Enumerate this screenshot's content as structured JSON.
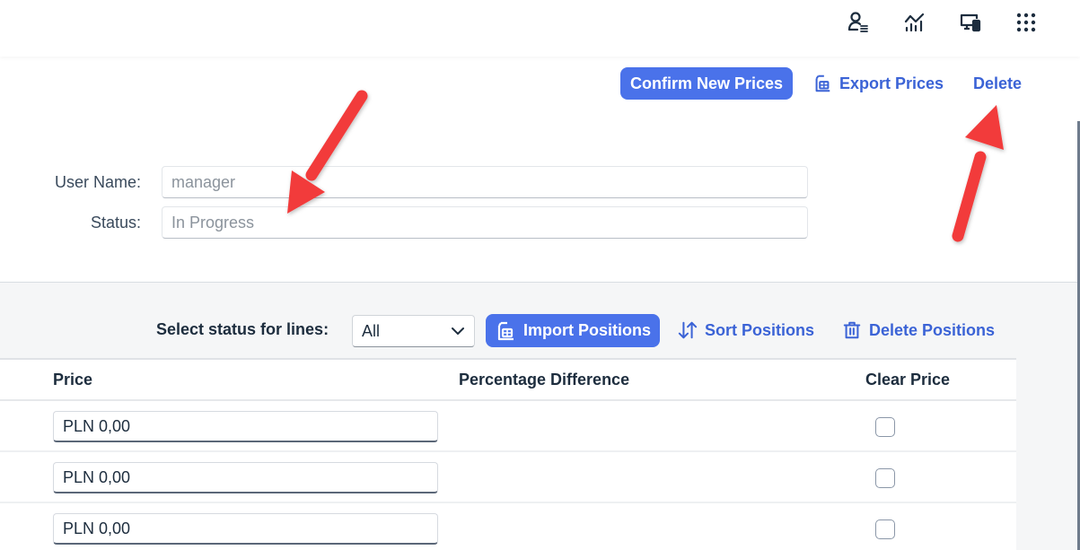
{
  "shellbar": {
    "icons": [
      {
        "name": "user-settings-icon"
      },
      {
        "name": "analytics-icon"
      },
      {
        "name": "device-icon"
      },
      {
        "name": "app-grid-icon"
      }
    ]
  },
  "header": {
    "actions": {
      "confirm_label": "Confirm New Prices",
      "export_label": "Export Prices",
      "delete_label": "Delete"
    },
    "fields": {
      "user_name_label": "User Name:",
      "user_name_value": "manager",
      "status_label": "Status:",
      "status_value": "In Progress"
    }
  },
  "toolbar": {
    "status_filter_label": "Select status for lines:",
    "status_filter_value": "All",
    "import_label": "Import Positions",
    "sort_label": "Sort Positions",
    "delete_label": "Delete Positions"
  },
  "table": {
    "columns": [
      "Price",
      "Percentage Difference",
      "Clear Price"
    ],
    "rows": [
      {
        "price": "PLN 0,00",
        "percentage_difference": "",
        "clear_price": false
      },
      {
        "price": "PLN 0,00",
        "percentage_difference": "",
        "clear_price": false
      },
      {
        "price": "PLN 0,00",
        "percentage_difference": "",
        "clear_price": false
      }
    ]
  },
  "annotations": {
    "arrow_color": "#f23b3b",
    "arrows": [
      {
        "points_to": "status-field"
      },
      {
        "points_to": "delete-button"
      }
    ]
  },
  "colors": {
    "accent": "#4a72ea",
    "link": "#3b63d6",
    "text": "#1d2d3e",
    "background": "#f5f6f7"
  }
}
